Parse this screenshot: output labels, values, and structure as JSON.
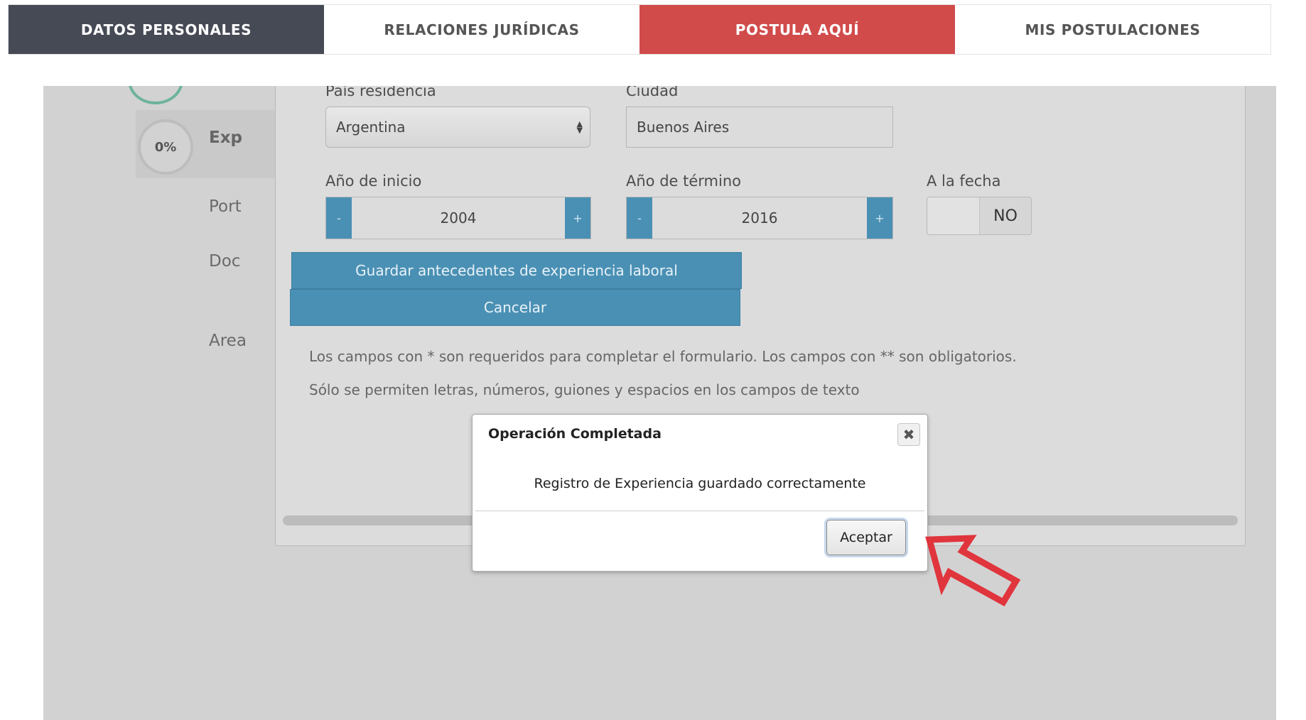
{
  "nav": {
    "tabs": [
      "DATOS PERSONALES",
      "RELACIONES JURÍDICAS",
      "POSTULA AQUÍ",
      "MIS POSTULACIONES"
    ]
  },
  "sidebar": {
    "step_percent": "0%",
    "step_label": "Exp",
    "items": [
      "Port",
      "Doc",
      "Area"
    ]
  },
  "form": {
    "pais_label": "País residencia",
    "pais_value": "Argentina",
    "ciudad_label": "Ciudad",
    "ciudad_value": "Buenos Aires",
    "inicio_label": "Año de inicio",
    "inicio_value": "2004",
    "termino_label": "Año de término",
    "termino_value": "2016",
    "fecha_label": "A la fecha",
    "fecha_value": "NO",
    "minus": "-",
    "plus": "+",
    "save_button": "Guardar antecedentes de experiencia laboral",
    "cancel_button": "Cancelar",
    "note_required": "Los campos con * son requeridos para completar el formulario. Los campos con ** son obligatorios.",
    "note_chars": "Sólo se permiten letras, números, guiones y espacios en los campos de texto"
  },
  "dialog": {
    "title": "Operación Completada",
    "close_glyph": "✖",
    "message": "Registro de Experiencia guardado correctamente",
    "ok_button": "Aceptar"
  },
  "colors": {
    "nav_dark": "#464a55",
    "nav_red": "#d14b4b",
    "accent_blue": "#4a90b4",
    "arrow_red": "#e0353d"
  },
  "icons": [
    "select-arrows-icon",
    "close-icon",
    "pointer-arrow-icon"
  ]
}
